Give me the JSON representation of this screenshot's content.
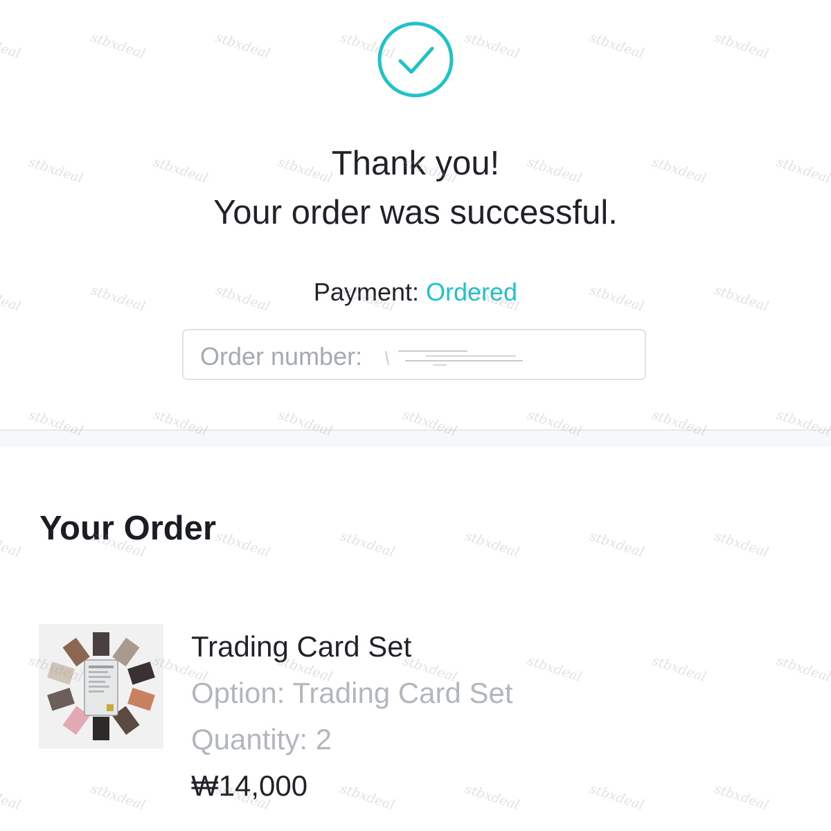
{
  "success": {
    "icon": "checkmark-circle-icon",
    "accent_color": "#1ec3c9",
    "line1": "Thank you!",
    "line2": "Your order was successful."
  },
  "payment": {
    "label": "Payment: ",
    "status": "Ordered"
  },
  "order_number": {
    "label": "Order number: "
  },
  "order": {
    "title": "Your Order",
    "items": [
      {
        "name": "Trading Card Set",
        "option": "Option: Trading Card Set",
        "quantity": "Quantity: 2",
        "price": "₩14,000",
        "thumbnail": "trading-card-set-thumbnail"
      }
    ]
  },
  "watermark": "stbxdeal"
}
